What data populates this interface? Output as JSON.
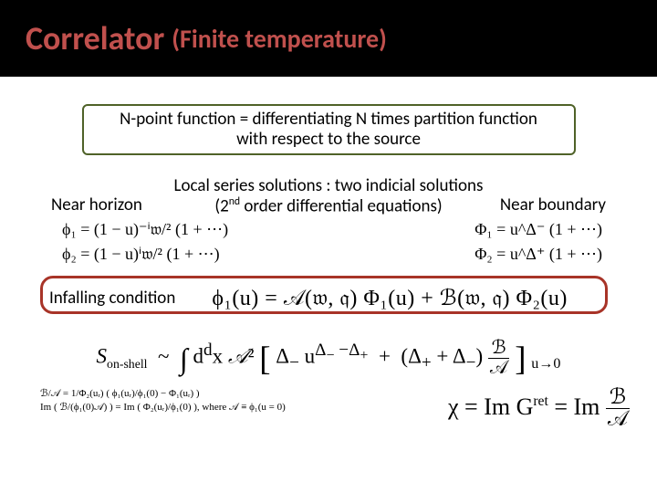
{
  "title": {
    "main": "Correlator",
    "sub": "(Finite temperature)"
  },
  "npoint": {
    "line1": "N-point function = differentiating N times partition function",
    "line2": "with respect to the source"
  },
  "local": {
    "line1": "Local series solutions : two indicial solutions",
    "line2a": "(2",
    "line2sup": "nd",
    "line2b": " order differential equations)"
  },
  "near": {
    "horizon": "Near horizon",
    "boundary": "Near boundary"
  },
  "horizon_eq": {
    "phi1": "ϕ₁ = (1 − u)⁻ⁱ𝔴/² (1 + ⋯)",
    "phi2": "ϕ₂ = (1 − u)ⁱ𝔴/² (1 + ⋯)"
  },
  "boundary_eq": {
    "phi1": "Φ₁ = u^Δ⁻ (1 + ⋯)",
    "phi2": "Φ₂ = u^Δ⁺ (1 + ⋯)"
  },
  "infalling": {
    "label": "Infalling condition",
    "eq": "ϕ₁(u) = 𝒜(𝔴, 𝔮) Φ₁(u) + ℬ(𝔴, 𝔮) Φ₂(u)"
  },
  "onshell": "S_on-shell ~ ∫ dᵈx 𝒜² [ Δ₋ u^(Δ₋ − Δ₊) + (Δ₊ + Δ₋) ℬ/𝒜 ]  | u→0",
  "bottom_left": {
    "l1": "ℬ/𝒜 = 1/Φ₂(uᵣ) ( ϕ₁(uᵣ)/ϕ₁(0)  − Φ₁(uᵣ) )",
    "l2": "Im ( ℬ/(ϕ₁(0)𝒜) ) = Im ( Φ₂(uᵣ)/ϕ₁(0) ),  where 𝒜 ≡ ϕ₁(u = 0)"
  },
  "bottom_right": "χ = Im G^ret = Im ℬ/𝒜"
}
